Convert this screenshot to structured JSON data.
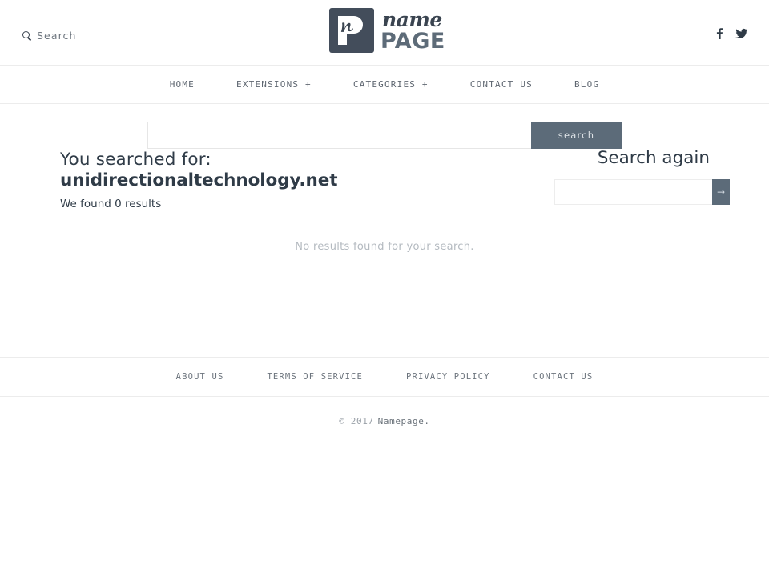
{
  "header": {
    "search_link_label": "Search",
    "search_icon": "magnifier-icon",
    "logo": {
      "script_word": "name",
      "block_word": "PAGE",
      "mark_letter": "n"
    },
    "socials": [
      {
        "name": "facebook-icon",
        "glyph": "f"
      },
      {
        "name": "twitter-icon",
        "glyph": "bird"
      }
    ]
  },
  "nav": {
    "items": [
      {
        "label": "HOME"
      },
      {
        "label": "EXTENSIONS +"
      },
      {
        "label": "CATEGORIES +"
      },
      {
        "label": "CONTACT US"
      },
      {
        "label": "BLOG"
      }
    ]
  },
  "search_bar": {
    "value": "",
    "placeholder": "",
    "button_label": "search"
  },
  "main": {
    "searched_for_label": "You searched for:",
    "query": "unidirectionaltechnology.net",
    "results_count_text": "We found 0 results",
    "no_results_text": "No results found for your search.",
    "search_again": {
      "title": "Search again",
      "value": "",
      "placeholder": "",
      "button_label": "→"
    }
  },
  "footer": {
    "links": [
      {
        "label": "ABOUT US"
      },
      {
        "label": "TERMS OF SERVICE"
      },
      {
        "label": "PRIVACY POLICY"
      },
      {
        "label": "CONTACT US"
      }
    ],
    "copyright_prefix": "© 2017",
    "copyright_brand": "Namepage."
  },
  "colors": {
    "accent": "#5c6b79",
    "heading": "#2f3b47",
    "muted": "#b4bac0",
    "border": "#ececec",
    "logo_mark": "#434d5b"
  }
}
